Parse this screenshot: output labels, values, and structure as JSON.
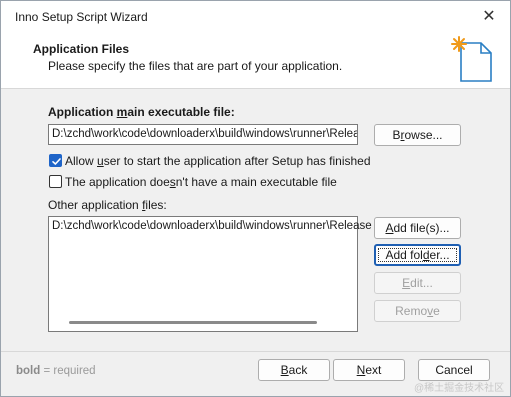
{
  "window": {
    "title": "Inno Setup Script Wizard",
    "close_glyph": "✕"
  },
  "header": {
    "title": "Application Files",
    "subtitle": "Please specify the files that are part of your application."
  },
  "main_exe": {
    "label_pre": "Application ",
    "label_u": "m",
    "label_post": "ain executable file:",
    "value": "D:\\zchd\\work\\code\\downloaderx\\build\\windows\\runner\\Release",
    "browse_pre": "B",
    "browse_u": "r",
    "browse_post": "owse..."
  },
  "options": {
    "allow_start_pre": "Allow ",
    "allow_start_u": "u",
    "allow_start_post": "ser to start the application after Setup has finished",
    "allow_start_checked": true,
    "no_exe_pre": "The application doe",
    "no_exe_u": "s",
    "no_exe_post": "n't have a main executable file",
    "no_exe_checked": false
  },
  "other_files": {
    "label_pre": "Other application ",
    "label_u": "f",
    "label_post": "iles:",
    "items": [
      "D:\\zchd\\work\\code\\downloaderx\\build\\windows\\runner\\Release"
    ],
    "add_files_pre": "",
    "add_files_u": "A",
    "add_files_post": "dd file(s)...",
    "add_folder_pre": "Add fol",
    "add_folder_u": "d",
    "add_folder_post": "er...",
    "edit_pre": "",
    "edit_u": "E",
    "edit_post": "dit...",
    "remove_pre": "Remo",
    "remove_u": "v",
    "remove_post": "e"
  },
  "footer": {
    "hint_bold": "bold",
    "hint_rest": " = required",
    "back_pre": "",
    "back_u": "B",
    "back_post": "ack",
    "next_pre": "",
    "next_u": "N",
    "next_post": "ext",
    "cancel": "Cancel"
  },
  "watermark": "@稀土掘金技术社区"
}
